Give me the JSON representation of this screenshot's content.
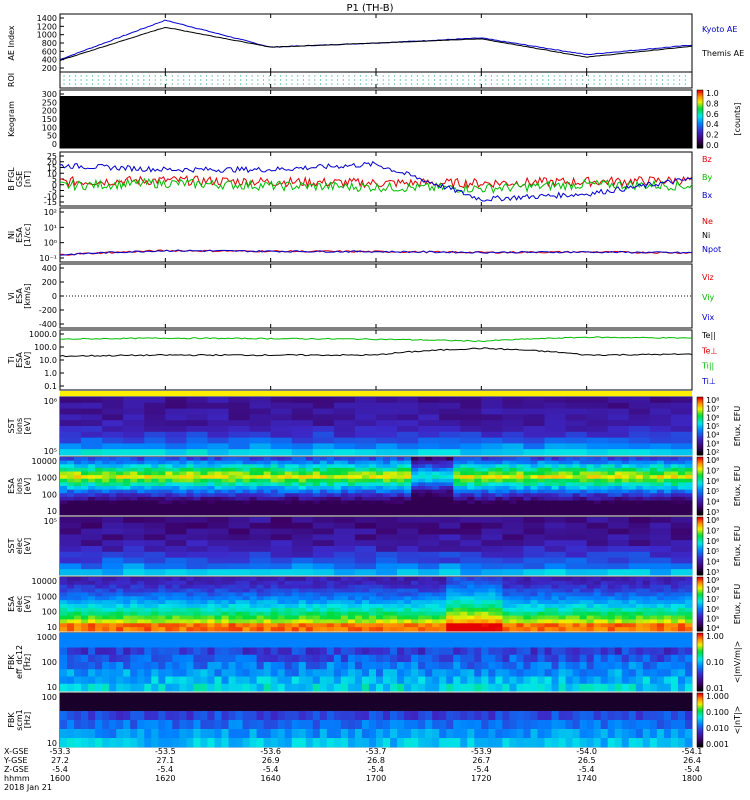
{
  "title": "P1 (TH-B)",
  "footer": {
    "row_labels": [
      "X-GSE",
      "Y-GSE",
      "Z-GSE",
      "hhmm",
      "2018 Jan 21"
    ],
    "columns": [
      {
        "x": "-53.3",
        "y": "27.2",
        "z": "-5.4",
        "t": "1600"
      },
      {
        "x": "-53.5",
        "y": "27.1",
        "z": "-5.4",
        "t": "1620"
      },
      {
        "x": "-53.6",
        "y": "26.9",
        "z": "-5.4",
        "t": "1640"
      },
      {
        "x": "-53.7",
        "y": "26.8",
        "z": "-5.4",
        "t": "1700"
      },
      {
        "x": "-53.9",
        "y": "26.7",
        "z": "-5.4",
        "t": "1720"
      },
      {
        "x": "-54.0",
        "y": "26.5",
        "z": "-5.4",
        "t": "1740"
      },
      {
        "x": "-54.1",
        "y": "26.4",
        "z": "-5.4",
        "t": "1800"
      }
    ]
  },
  "panels": {
    "ae": {
      "ylabel": "AE Index",
      "ticks": [
        "1400",
        "1200",
        "1000",
        "800",
        "600",
        "400",
        "200"
      ],
      "legend": [
        "Kyoto AE",
        "Themis AE"
      ],
      "colors": [
        "#0000cc",
        "#000000"
      ]
    },
    "roi": {
      "ylabel": "ROI"
    },
    "keogram": {
      "ylabel": "Keogram",
      "ticks": [
        "300",
        "250",
        "200",
        "150",
        "100",
        "50",
        "0"
      ],
      "cbar_ticks": [
        "1.0",
        "0.8",
        "0.6",
        "0.4",
        "0.2",
        "0.0"
      ],
      "cbar_label": "[counts]"
    },
    "bfield": {
      "ylabel": [
        "B FGL",
        "GSE",
        "[nT]"
      ],
      "ticks": [
        "25",
        "20",
        "15",
        "10",
        "5",
        "0",
        "-5",
        "-10",
        "-15"
      ],
      "legend": [
        "Bz",
        "By",
        "Bx"
      ],
      "colors": [
        "#dd0000",
        "#00bb00",
        "#0000cc"
      ]
    },
    "density": {
      "ylabel": [
        "Ni",
        "ESA",
        "[1/cc]"
      ],
      "ticks": [
        "10²",
        "10¹",
        "10⁰",
        "10⁻¹"
      ],
      "legend": [
        "Ne",
        "Ni",
        "Npot"
      ],
      "colors": [
        "#dd0000",
        "#000000",
        "#0000cc"
      ]
    },
    "velocity": {
      "ylabel": [
        "Vi",
        "ESA",
        "[km/s]"
      ],
      "ticks": [
        "400",
        "200",
        "0",
        "-200",
        "-400"
      ],
      "legend": [
        "Viz",
        "Viy",
        "Vix"
      ],
      "colors": [
        "#dd0000",
        "#00bb00",
        "#0000cc"
      ]
    },
    "temp": {
      "ylabel": [
        "Ti",
        "ESA",
        "[eV]"
      ],
      "ticks": [
        "1000.0",
        "100.0",
        "10.0",
        "1.0",
        "0.1"
      ],
      "legend": [
        "Te||",
        "Te⊥",
        "Ti||",
        "Ti⊥"
      ],
      "colors": [
        "#000000",
        "#dd0000",
        "#00bb00",
        "#0000cc"
      ]
    },
    "sst_i": {
      "ylabel": [
        "SST",
        "ions",
        "[eV]"
      ],
      "ticks": [
        "10⁶",
        "10⁵"
      ],
      "cbar_ticks": [
        "10⁸",
        "10⁷",
        "10⁶",
        "10⁵",
        "10⁴",
        "10³",
        "10²"
      ],
      "cbar_label": "Eflux, EFU"
    },
    "esa_i": {
      "ylabel": [
        "ESA",
        "ions",
        "[eV]"
      ],
      "ticks": [
        "10000",
        "1000",
        "100",
        "10"
      ],
      "cbar_ticks": [
        "10⁸",
        "10⁷",
        "10⁶",
        "10⁵",
        "10⁴",
        "10³"
      ],
      "cbar_label": "Eflux, EFU"
    },
    "sst_e": {
      "ylabel": [
        "SST",
        "elec",
        "[eV]"
      ],
      "ticks": [
        "10⁵"
      ],
      "cbar_ticks": [
        "10⁸",
        "10⁷",
        "10⁶",
        "10⁵",
        "10⁴",
        "10³"
      ],
      "cbar_label": "Eflux, EFU"
    },
    "esa_e": {
      "ylabel": [
        "ESA",
        "elec",
        "[eV]"
      ],
      "ticks": [
        "10000",
        "1000",
        "100",
        "10"
      ],
      "cbar_ticks": [
        "10⁹",
        "10⁸",
        "10⁷",
        "10⁶",
        "10⁵",
        "10⁴"
      ],
      "cbar_label": "Eflux, EFU"
    },
    "fbk_e": {
      "ylabel": [
        "FBK",
        "eff_dc12",
        "[Hz]"
      ],
      "ticks": [
        "1000",
        "100",
        "10"
      ],
      "cbar_ticks": [
        "1.00",
        "0.10",
        "0.01"
      ],
      "cbar_label": "<|mV/m|>"
    },
    "fbk_b": {
      "ylabel": [
        "FBK",
        "scm1",
        "[Hz]"
      ],
      "ticks": [
        "100",
        "10"
      ],
      "cbar_ticks": [
        "1.000",
        "0.100",
        "0.010",
        "0.001"
      ],
      "cbar_label": "<|nT|>"
    }
  },
  "chart_data": [
    {
      "type": "line",
      "panel": "ae",
      "xlabel": "hhmm",
      "x": [
        "1600",
        "1620",
        "1640",
        "1700",
        "1720",
        "1740",
        "1800"
      ],
      "ylim": [
        0,
        1400
      ],
      "series": [
        {
          "name": "Kyoto AE",
          "values": [
            300,
            1250,
            600,
            700,
            820,
            420,
            650
          ]
        },
        {
          "name": "Themis AE",
          "values": [
            280,
            1080,
            600,
            700,
            800,
            360,
            620
          ]
        }
      ]
    },
    {
      "type": "line",
      "panel": "bfield",
      "ylim": [
        -15,
        25
      ],
      "series": [
        {
          "name": "Bz",
          "values": [
            3,
            4,
            3,
            2,
            2,
            3,
            4
          ]
        },
        {
          "name": "By",
          "values": [
            0,
            2,
            0,
            -1,
            -2,
            1,
            0
          ]
        },
        {
          "name": "Bx",
          "values": [
            15,
            12,
            12,
            16,
            -10,
            -6,
            5
          ]
        }
      ]
    },
    {
      "type": "line",
      "panel": "temp",
      "ylim": [
        0.1,
        1000
      ],
      "series": [
        {
          "name": "Te||",
          "values": [
            500,
            600,
            550,
            500,
            400,
            700,
            600
          ]
        },
        {
          "name": "Ti||",
          "values": [
            25,
            30,
            30,
            30,
            100,
            30,
            35
          ]
        }
      ]
    }
  ]
}
